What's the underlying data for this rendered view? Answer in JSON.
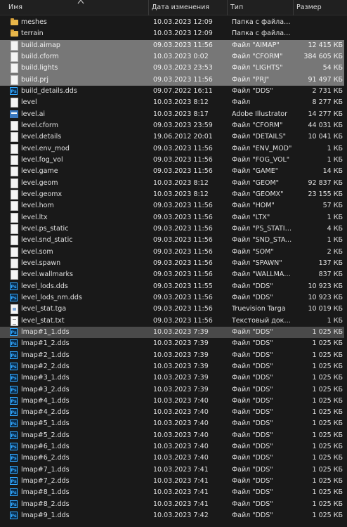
{
  "columns": {
    "name": "Имя",
    "date": "Дата изменения",
    "type": "Тип",
    "size": "Размер"
  },
  "rows": [
    {
      "name": "meshes",
      "date": "10.03.2023 12:09",
      "type": "Папка с файлами",
      "size": "",
      "icon": "folder-icon",
      "state": ""
    },
    {
      "name": "terrain",
      "date": "10.03.2023 12:09",
      "type": "Папка с файлами",
      "size": "",
      "icon": "folder-icon",
      "state": ""
    },
    {
      "name": "build.aimap",
      "date": "09.03.2023 11:56",
      "type": "Файл \"AIMAP\"",
      "size": "12 415 КБ",
      "icon": "file-icon",
      "state": "sel"
    },
    {
      "name": "build.cform",
      "date": "10.03.2023 0:02",
      "type": "Файл \"CFORM\"",
      "size": "384 605 КБ",
      "icon": "file-icon",
      "state": "sel"
    },
    {
      "name": "build.lights",
      "date": "09.03.2023 23:53",
      "type": "Файл \"LIGHTS\"",
      "size": "54 КБ",
      "icon": "file-icon",
      "state": "sel"
    },
    {
      "name": "build.prj",
      "date": "09.03.2023 11:56",
      "type": "Файл \"PRJ\"",
      "size": "91 497 КБ",
      "icon": "file-icon",
      "state": "sel"
    },
    {
      "name": "build_details.dds",
      "date": "09.07.2022 16:11",
      "type": "Файл \"DDS\"",
      "size": "2 731 КБ",
      "icon": "photoshop-icon",
      "state": ""
    },
    {
      "name": "level",
      "date": "10.03.2023 8:12",
      "type": "Файл",
      "size": "8 277 КБ",
      "icon": "file-icon",
      "state": ""
    },
    {
      "name": "level.ai",
      "date": "10.03.2023 8:17",
      "type": "Adobe Illustrator",
      "size": "14 277 КБ",
      "icon": "illustrator-icon",
      "state": ""
    },
    {
      "name": "level.cform",
      "date": "09.03.2023 23:59",
      "type": "Файл \"CFORM\"",
      "size": "44 031 КБ",
      "icon": "file-icon",
      "state": ""
    },
    {
      "name": "level.details",
      "date": "19.06.2012 20:01",
      "type": "Файл \"DETAILS\"",
      "size": "10 041 КБ",
      "icon": "file-icon",
      "state": ""
    },
    {
      "name": "level.env_mod",
      "date": "09.03.2023 11:56",
      "type": "Файл \"ENV_MOD\"",
      "size": "1 КБ",
      "icon": "file-icon",
      "state": ""
    },
    {
      "name": "level.fog_vol",
      "date": "09.03.2023 11:56",
      "type": "Файл \"FOG_VOL\"",
      "size": "1 КБ",
      "icon": "file-icon",
      "state": ""
    },
    {
      "name": "level.game",
      "date": "09.03.2023 11:56",
      "type": "Файл \"GAME\"",
      "size": "14 КБ",
      "icon": "file-icon",
      "state": ""
    },
    {
      "name": "level.geom",
      "date": "10.03.2023 8:12",
      "type": "Файл \"GEOM\"",
      "size": "92 837 КБ",
      "icon": "file-icon",
      "state": ""
    },
    {
      "name": "level.geomx",
      "date": "10.03.2023 8:12",
      "type": "Файл \"GEOMX\"",
      "size": "23 155 КБ",
      "icon": "file-icon",
      "state": ""
    },
    {
      "name": "level.hom",
      "date": "09.03.2023 11:56",
      "type": "Файл \"HOM\"",
      "size": "57 КБ",
      "icon": "file-icon",
      "state": ""
    },
    {
      "name": "level.ltx",
      "date": "09.03.2023 11:56",
      "type": "Файл \"LTX\"",
      "size": "1 КБ",
      "icon": "file-icon",
      "state": ""
    },
    {
      "name": "level.ps_static",
      "date": "09.03.2023 11:56",
      "type": "Файл \"PS_STATIC\"",
      "size": "4 КБ",
      "icon": "file-icon",
      "state": ""
    },
    {
      "name": "level.snd_static",
      "date": "09.03.2023 11:56",
      "type": "Файл \"SND_STATIC\"",
      "size": "1 КБ",
      "icon": "file-icon",
      "state": ""
    },
    {
      "name": "level.som",
      "date": "09.03.2023 11:56",
      "type": "Файл \"SOM\"",
      "size": "2 КБ",
      "icon": "file-icon",
      "state": ""
    },
    {
      "name": "level.spawn",
      "date": "09.03.2023 11:56",
      "type": "Файл \"SPAWN\"",
      "size": "137 КБ",
      "icon": "file-icon",
      "state": ""
    },
    {
      "name": "level.wallmarks",
      "date": "09.03.2023 11:56",
      "type": "Файл \"WALLMAR...",
      "size": "837 КБ",
      "icon": "file-icon",
      "state": ""
    },
    {
      "name": "level_lods.dds",
      "date": "09.03.2023 11:55",
      "type": "Файл \"DDS\"",
      "size": "10 923 КБ",
      "icon": "photoshop-icon",
      "state": ""
    },
    {
      "name": "level_lods_nm.dds",
      "date": "09.03.2023 11:56",
      "type": "Файл \"DDS\"",
      "size": "10 923 КБ",
      "icon": "photoshop-icon",
      "state": ""
    },
    {
      "name": "level_stat.tga",
      "date": "09.03.2023 11:56",
      "type": "Truevision Targa",
      "size": "10 019 КБ",
      "icon": "tga-icon",
      "state": ""
    },
    {
      "name": "level_stat.txt",
      "date": "09.03.2023 11:56",
      "type": "Текстовый докум...",
      "size": "1 КБ",
      "icon": "text-file-icon",
      "state": ""
    },
    {
      "name": "lmap#1_1.dds",
      "date": "10.03.2023 7:39",
      "type": "Файл \"DDS\"",
      "size": "1 025 КБ",
      "icon": "photoshop-icon",
      "state": "hover"
    },
    {
      "name": "lmap#1_2.dds",
      "date": "10.03.2023 7:39",
      "type": "Файл \"DDS\"",
      "size": "1 025 КБ",
      "icon": "photoshop-icon",
      "state": ""
    },
    {
      "name": "lmap#2_1.dds",
      "date": "10.03.2023 7:39",
      "type": "Файл \"DDS\"",
      "size": "1 025 КБ",
      "icon": "photoshop-icon",
      "state": ""
    },
    {
      "name": "lmap#2_2.dds",
      "date": "10.03.2023 7:39",
      "type": "Файл \"DDS\"",
      "size": "1 025 КБ",
      "icon": "photoshop-icon",
      "state": ""
    },
    {
      "name": "lmap#3_1.dds",
      "date": "10.03.2023 7:39",
      "type": "Файл \"DDS\"",
      "size": "1 025 КБ",
      "icon": "photoshop-icon",
      "state": ""
    },
    {
      "name": "lmap#3_2.dds",
      "date": "10.03.2023 7:39",
      "type": "Файл \"DDS\"",
      "size": "1 025 КБ",
      "icon": "photoshop-icon",
      "state": ""
    },
    {
      "name": "lmap#4_1.dds",
      "date": "10.03.2023 7:40",
      "type": "Файл \"DDS\"",
      "size": "1 025 КБ",
      "icon": "photoshop-icon",
      "state": ""
    },
    {
      "name": "lmap#4_2.dds",
      "date": "10.03.2023 7:40",
      "type": "Файл \"DDS\"",
      "size": "1 025 КБ",
      "icon": "photoshop-icon",
      "state": ""
    },
    {
      "name": "lmap#5_1.dds",
      "date": "10.03.2023 7:40",
      "type": "Файл \"DDS\"",
      "size": "1 025 КБ",
      "icon": "photoshop-icon",
      "state": ""
    },
    {
      "name": "lmap#5_2.dds",
      "date": "10.03.2023 7:40",
      "type": "Файл \"DDS\"",
      "size": "1 025 КБ",
      "icon": "photoshop-icon",
      "state": ""
    },
    {
      "name": "lmap#6_1.dds",
      "date": "10.03.2023 7:40",
      "type": "Файл \"DDS\"",
      "size": "1 025 КБ",
      "icon": "photoshop-icon",
      "state": ""
    },
    {
      "name": "lmap#6_2.dds",
      "date": "10.03.2023 7:40",
      "type": "Файл \"DDS\"",
      "size": "1 025 КБ",
      "icon": "photoshop-icon",
      "state": ""
    },
    {
      "name": "lmap#7_1.dds",
      "date": "10.03.2023 7:41",
      "type": "Файл \"DDS\"",
      "size": "1 025 КБ",
      "icon": "photoshop-icon",
      "state": ""
    },
    {
      "name": "lmap#7_2.dds",
      "date": "10.03.2023 7:41",
      "type": "Файл \"DDS\"",
      "size": "1 025 КБ",
      "icon": "photoshop-icon",
      "state": ""
    },
    {
      "name": "lmap#8_1.dds",
      "date": "10.03.2023 7:41",
      "type": "Файл \"DDS\"",
      "size": "1 025 КБ",
      "icon": "photoshop-icon",
      "state": ""
    },
    {
      "name": "lmap#8_2.dds",
      "date": "10.03.2023 7:41",
      "type": "Файл \"DDS\"",
      "size": "1 025 КБ",
      "icon": "photoshop-icon",
      "state": ""
    },
    {
      "name": "lmap#9_1.dds",
      "date": "10.03.2023 7:42",
      "type": "Файл \"DDS\"",
      "size": "1 025 КБ",
      "icon": "photoshop-icon",
      "state": ""
    }
  ]
}
